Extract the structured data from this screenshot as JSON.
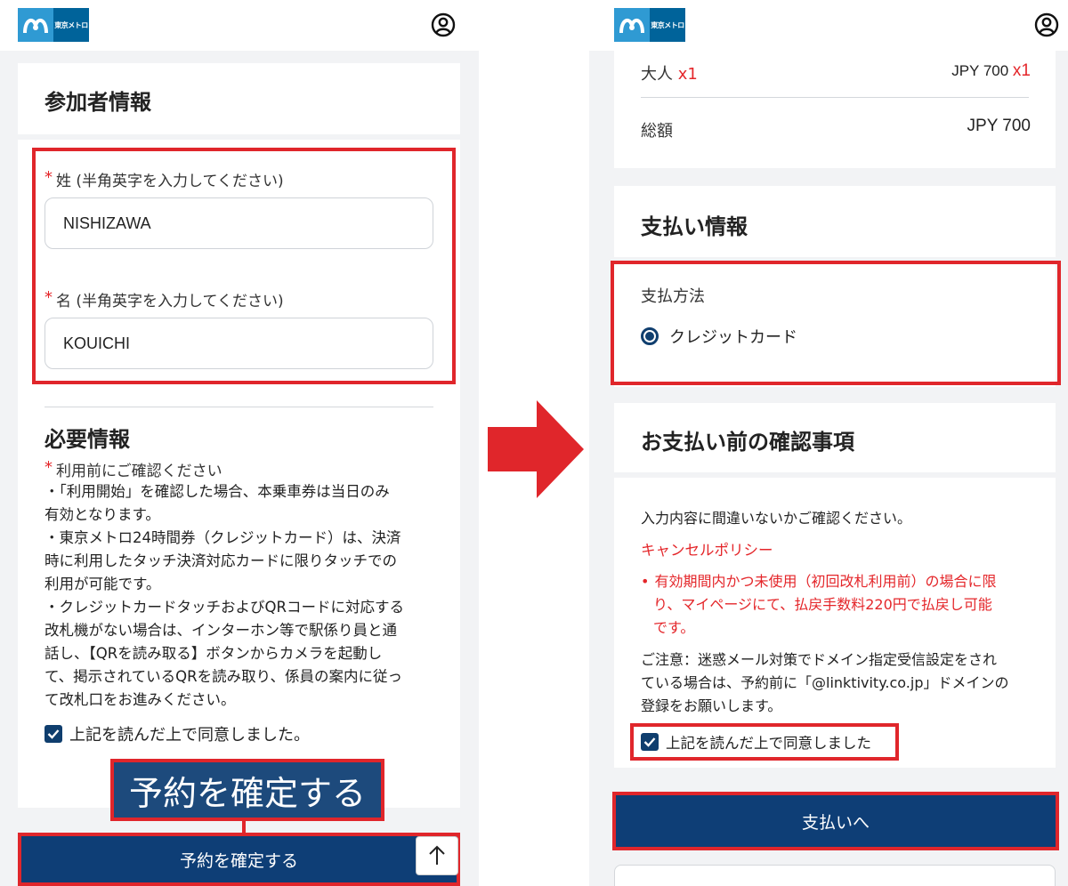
{
  "brand": {
    "logo_text": "東京メトロ"
  },
  "left": {
    "participant": {
      "title": "参加者情報",
      "last_name_label": "姓 (半角英字を入力してください)",
      "last_name_value": "NISHIZAWA",
      "first_name_label": "名 (半角英字を入力してください)",
      "first_name_value": "KOUICHI",
      "required_mark": "*"
    },
    "required_info": {
      "title": "必要情報",
      "notice_label": "利用前にご確認ください",
      "notice_lines": [
        "・「利用開始」を確認した場合、本乗車券は当日のみ",
        "有効となります。",
        "・東京メトロ24時間券（クレジットカード）は、決済",
        "時に利用したタッチ決済対応カードに限りタッチでの",
        "利用が可能です。",
        "・クレジットカードタッチおよびQRコードに対応する",
        "改札機がない場合は、インターホン等で駅係り員と通",
        "話し、【QRを読み取る】ボタンからカメラを起動し",
        "て、掲示されているQRを読み取り、係員の案内に従っ",
        "て改札口をお進みください。"
      ],
      "agree_label": "上記を読んだ上で同意しました。",
      "agree_checked": true
    },
    "callout_text": "予約を確定する",
    "confirm_button": "予約を確定する",
    "scroll_top": "↑"
  },
  "right": {
    "price": {
      "adult_label": "大人",
      "adult_qty": "x1",
      "adult_price": "JPY 700",
      "adult_price_qty": "x1",
      "total_label": "総額",
      "total_value": "JPY 700"
    },
    "payment": {
      "title": "支払い情報",
      "method_label": "支払方法",
      "method_option": "クレジットカード",
      "selected": true
    },
    "confirm": {
      "title": "お支払い前の確認事項",
      "intro": "入力内容に間違いないかご確認ください。",
      "cancel_policy": "キャンセルポリシー",
      "policy_lines": [
        "有効期間内かつ未使用（初回改札利用前）の場合に限",
        "り、マイページにて、払戻手数料220円で払戻し可能",
        "です。"
      ],
      "caution_lines": [
        "ご注意：迷惑メール対策でドメイン指定受信設定をされ",
        "ている場合は、予約前に「@linktivity.co.jp」ドメインの",
        "登録をお願いします。"
      ],
      "agree_label": "上記を読んだ上で同意しました",
      "agree_checked": true
    },
    "pay_button": "支払いへ"
  },
  "colors": {
    "accent_red": "#e0262b",
    "navy": "#0e3e76",
    "metro_blue": "#2f9ad3"
  }
}
